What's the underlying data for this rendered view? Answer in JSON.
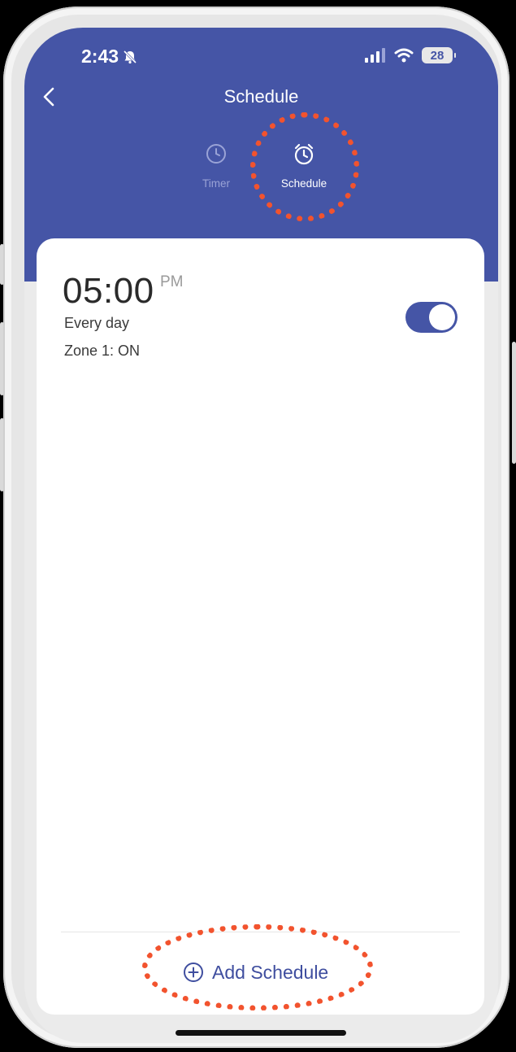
{
  "status_bar": {
    "time": "2:43",
    "battery": "28"
  },
  "header": {
    "title": "Schedule"
  },
  "tabs": [
    {
      "label": "Timer",
      "icon": "clock-icon",
      "active": false
    },
    {
      "label": "Schedule",
      "icon": "alarm-clock-icon",
      "active": true
    }
  ],
  "schedule_item": {
    "time": "05:00",
    "ampm": "PM",
    "repeat": "Every day",
    "action": "Zone 1: ON",
    "enabled": true
  },
  "add_button": {
    "label": "Add Schedule",
    "icon": "plus-circle-icon"
  },
  "colors": {
    "header": "#4555a6",
    "accent": "#3f4e9f",
    "annotation": "#f2532e"
  }
}
